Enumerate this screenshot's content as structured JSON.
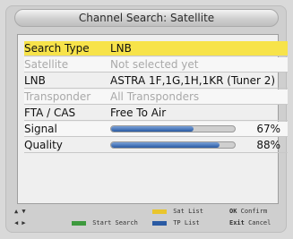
{
  "title": "Channel Search: Satellite",
  "rows": [
    {
      "label": "Search Type",
      "value": "LNB"
    },
    {
      "label": "Satellite",
      "value": "Not selected yet"
    },
    {
      "label": "LNB",
      "value": "ASTRA 1F,1G,1H,1KR (Tuner  2)"
    },
    {
      "label": "Transponder",
      "value": "All Transponders"
    },
    {
      "label": "FTA / CAS",
      "value": "Free To Air"
    },
    {
      "label": "Signal",
      "percent": "67%",
      "level": 0.67
    },
    {
      "label": "Quality",
      "percent": "88%",
      "level": 0.88
    }
  ],
  "footer": {
    "nav_updown": "▲ ▼",
    "nav_leftright": "◀ ▶",
    "start_search": "Start Search",
    "sat_list": "Sat List",
    "tp_list": "TP List",
    "ok": "OK",
    "confirm": "Confirm",
    "exit": "Exit",
    "cancel": "Cancel"
  },
  "colors": {
    "selected": "#f7e34a",
    "green": "#3e9a3e",
    "yellow": "#e9c52d",
    "blue": "#2a5aa3"
  }
}
